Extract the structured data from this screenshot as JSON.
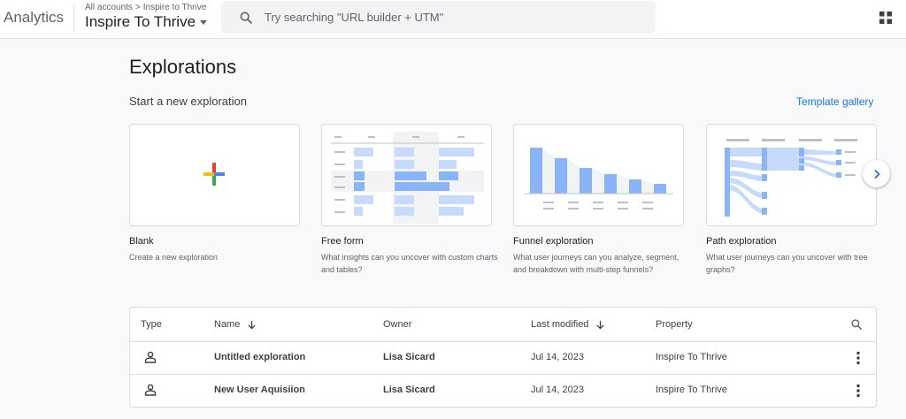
{
  "header": {
    "brand": "Analytics",
    "breadcrumb": {
      "accounts": "All accounts",
      "separator": ">",
      "account": "Inspire to Thrive"
    },
    "property": "Inspire To Thrive",
    "search_placeholder": "Try searching \"URL builder + UTM\""
  },
  "page": {
    "title": "Explorations",
    "section_title": "Start a new exploration",
    "template_link": "Template gallery"
  },
  "templates": [
    {
      "title": "Blank",
      "description": "Create a new exploration"
    },
    {
      "title": "Free form",
      "description": "What insights can you uncover with custom charts and tables?"
    },
    {
      "title": "Funnel exploration",
      "description": "What user journeys can you analyze, segment, and breakdown with multi-step funnels?"
    },
    {
      "title": "Path exploration",
      "description": "What user journeys can you uncover with tree graphs?"
    }
  ],
  "table": {
    "columns": {
      "type": "Type",
      "name": "Name",
      "owner": "Owner",
      "modified": "Last modified",
      "property": "Property"
    },
    "rows": [
      {
        "name": "Untitled exploration",
        "owner": "Lisa Sicard",
        "modified": "Jul 14, 2023",
        "property": "Inspire To Thrive"
      },
      {
        "name": "New User Aquisiion",
        "owner": "Lisa Sicard",
        "modified": "Jul 14, 2023",
        "property": "Inspire To Thrive"
      }
    ]
  },
  "colors": {
    "accent": "#1a73e8",
    "plus_red": "#ea4335",
    "plus_blue": "#4285f4",
    "plus_yellow": "#fbbc04",
    "plus_green": "#34a853",
    "chart_blue": "#8ab4f8"
  }
}
